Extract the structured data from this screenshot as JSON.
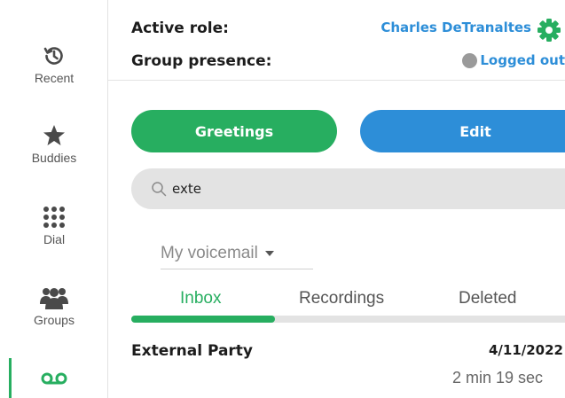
{
  "sidebar": {
    "items": [
      {
        "label": "Recent",
        "icon": "history-icon"
      },
      {
        "label": "Buddies",
        "icon": "star-icon"
      },
      {
        "label": "Dial",
        "icon": "dialpad-icon"
      },
      {
        "label": "Groups",
        "icon": "people-icon"
      },
      {
        "label": "",
        "icon": "voicemail-icon",
        "active": true
      }
    ]
  },
  "header": {
    "active_role_label": "Active role:",
    "active_role_value": "Charles DeTranaltes",
    "group_presence_label": "Group presence:",
    "group_presence_value": "Logged out"
  },
  "buttons": {
    "greetings": "Greetings",
    "edit": "Edit"
  },
  "search": {
    "value": "exte"
  },
  "mailbox": {
    "selected": "My voicemail"
  },
  "tabs": [
    {
      "label": "Inbox",
      "active": true
    },
    {
      "label": "Recordings",
      "active": false
    },
    {
      "label": "Deleted",
      "active": false
    }
  ],
  "voicemails": [
    {
      "caller": "External Party",
      "date": "4/11/2022",
      "duration": "2 min 19 sec"
    }
  ],
  "colors": {
    "accent_green": "#27ae60",
    "accent_blue": "#2d8ed8",
    "presence_gray": "#9a9a9a"
  }
}
